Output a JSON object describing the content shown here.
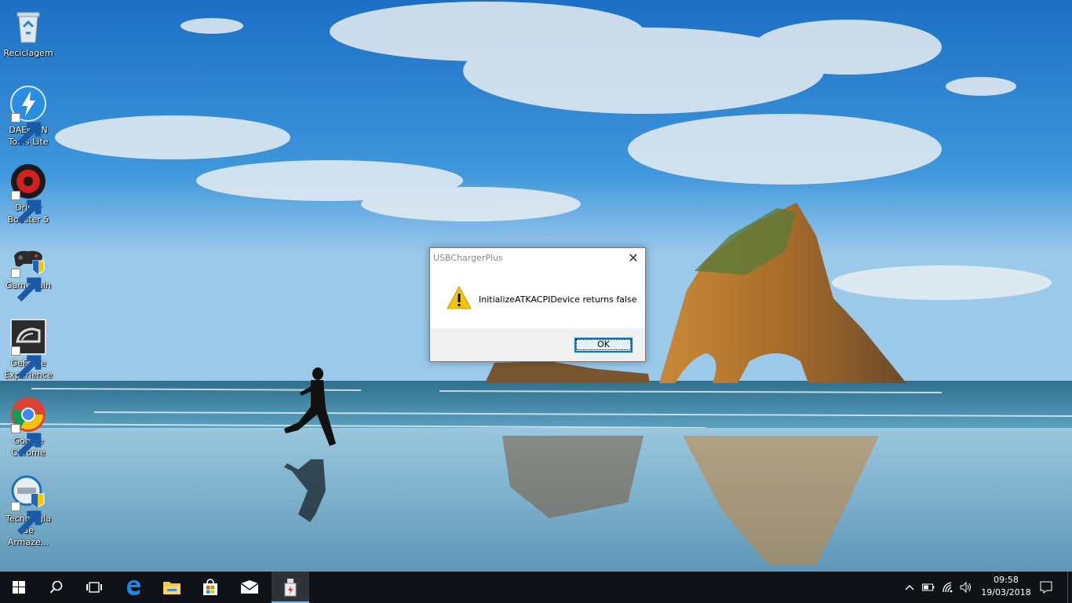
{
  "desktop": {
    "icons": [
      {
        "label_line1": "Reciclagem",
        "label_line2": "",
        "icon": "recycle-bin-icon"
      },
      {
        "label_line1": "DAEMON",
        "label_line2": "Tools Lite",
        "icon": "daemon-tools-icon"
      },
      {
        "label_line1": "Driver",
        "label_line2": "Booster 5",
        "icon": "driver-booster-icon"
      },
      {
        "label_line1": "GameGain",
        "label_line2": "",
        "icon": "gamegain-icon"
      },
      {
        "label_line1": "GeForce",
        "label_line2": "Experience",
        "icon": "geforce-icon"
      },
      {
        "label_line1": "Google",
        "label_line2": "Chrome",
        "icon": "chrome-icon"
      },
      {
        "label_line1": "Tecnologia",
        "label_line2": "de Armaze...",
        "icon": "intel-storage-icon"
      }
    ]
  },
  "dialog": {
    "title": "USBChargerPlus",
    "message": "InitializeATKACPIDevice returns false",
    "ok_label": "OK",
    "close_glyph": "✕"
  },
  "taskbar": {
    "apps": [
      "start-icon",
      "search-icon",
      "task-view-icon",
      "edge-icon",
      "file-explorer-icon",
      "store-icon",
      "mail-icon",
      "usbchargerplus-icon"
    ],
    "clock": {
      "time": "09:58",
      "date": "19/03/2018"
    }
  },
  "colors": {
    "accent": "#0078d7",
    "taskbar": "#0f1318",
    "warning": "#f5c400"
  }
}
